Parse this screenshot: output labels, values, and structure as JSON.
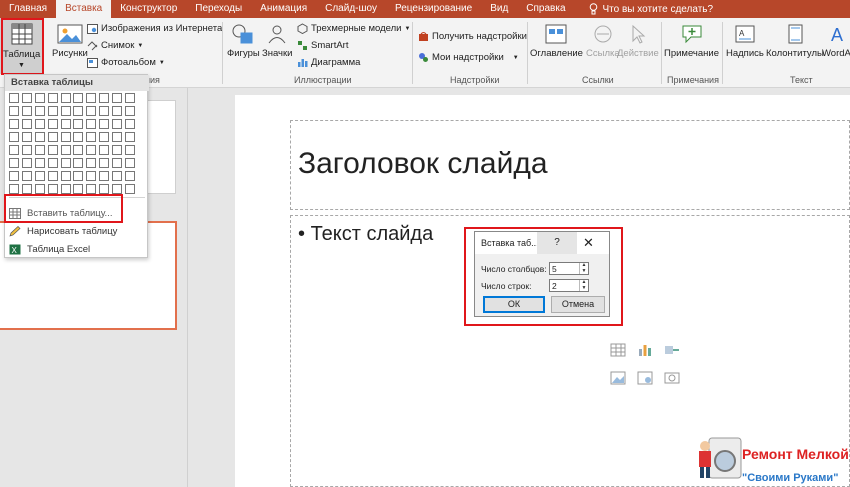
{
  "tabs": [
    {
      "label": "Главная",
      "active": false
    },
    {
      "label": "Вставка",
      "active": true
    },
    {
      "label": "Конструктор",
      "active": false
    },
    {
      "label": "Переходы",
      "active": false
    },
    {
      "label": "Анимация",
      "active": false
    },
    {
      "label": "Слайд-шоу",
      "active": false
    },
    {
      "label": "Рецензирование",
      "active": false
    },
    {
      "label": "Вид",
      "active": false
    },
    {
      "label": "Справка",
      "active": false
    }
  ],
  "tell_me": "Что вы хотите сделать?",
  "ribbon": {
    "table_label": "Таблица",
    "pictures_label": "Рисунки",
    "online_pictures": "Изображения из Интернета",
    "screenshot": "Снимок",
    "photo_album": "Фотоальбом",
    "images_group_partial": "ния",
    "shapes": "Фигуры",
    "icons": "Значки",
    "models_3d": "Трехмерные модели",
    "smartart": "SmartArt",
    "chart": "Диаграмма",
    "illustrations_group": "Иллюстрации",
    "get_addins": "Получить надстройки",
    "my_addins": "Мои надстройки",
    "addins_group": "Надстройки",
    "zoom": "Оглавление",
    "link": "Ссылка",
    "action": "Действие",
    "links_group": "Ссылки",
    "comment": "Примечание",
    "comments_group": "Примечания",
    "textbox": "Надпись",
    "header_footer": "Колонтитулы",
    "wordart": "WordArt",
    "text_group": "Текст"
  },
  "table_dropdown": {
    "header": "Вставка таблицы",
    "grid_cols": 10,
    "grid_rows": 8,
    "insert_table": "Вставить таблицу...",
    "draw_table": "Нарисовать таблицу",
    "excel_table": "Таблица Excel"
  },
  "slide": {
    "title": "Заголовок слайда",
    "bullet": "Текст слайда"
  },
  "dialog": {
    "title": "Вставка таб...",
    "help": "?",
    "close": "✕",
    "cols_label": "Число столбцов:",
    "cols_value": "5",
    "rows_label": "Число строк:",
    "rows_value": "2",
    "ok": "ОК",
    "cancel": "Отмена"
  },
  "watermark": {
    "line1": "Ремонт Мелкой",
    "line2": "\"Своими Руками\""
  },
  "colors": {
    "accent": "#b7472a",
    "highlight": "#e0161b",
    "selected_thumb": "#e2704c"
  }
}
